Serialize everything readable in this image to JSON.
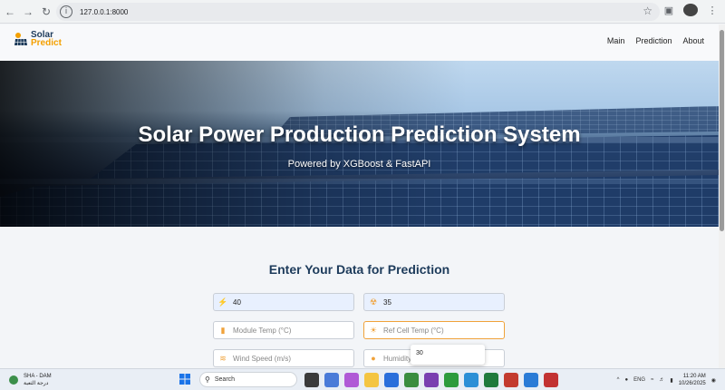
{
  "browser": {
    "url": "127.0.0.1:8000",
    "back_icon": "arrow-left-icon",
    "forward_icon": "arrow-right-icon",
    "reload_icon": "reload-icon"
  },
  "header": {
    "logo_line1": "Solar",
    "logo_line2": "Predict",
    "nav": [
      "Main",
      "Prediction",
      "About"
    ]
  },
  "hero": {
    "title": "Solar Power Production Prediction System",
    "subtitle": "Powered by XGBoost & FastAPI"
  },
  "form": {
    "title": "Enter Your Data for Prediction",
    "fields": [
      {
        "value": "40",
        "placeholder": "",
        "icon": "bolt-icon"
      },
      {
        "value": "35",
        "placeholder": "",
        "icon": "radiation-icon"
      },
      {
        "value": "",
        "placeholder": "Module Temp (°C)",
        "icon": "thermometer-icon"
      },
      {
        "value": "",
        "placeholder": "Ref Cell Temp (°C)",
        "icon": "sun-icon"
      },
      {
        "value": "",
        "placeholder": "Wind Speed (m/s)",
        "icon": "wind-icon"
      },
      {
        "value": "",
        "placeholder": "Humidity",
        "icon": "droplet-icon"
      }
    ],
    "autocomplete_option": "30"
  },
  "taskbar": {
    "weather_line1": "SHA - DAM",
    "weather_line2": "درجة الثعبة",
    "search_placeholder": "Search",
    "language": "ENG",
    "time": "11:20 AM",
    "date": "10/26/2025"
  },
  "colors": {
    "accent": "#f0a23a",
    "title": "#1d3b5b"
  }
}
